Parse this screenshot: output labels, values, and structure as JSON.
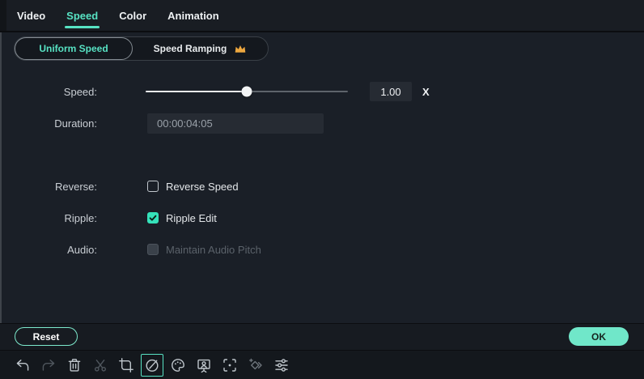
{
  "tabs": [
    {
      "label": "Video",
      "active": false
    },
    {
      "label": "Speed",
      "active": true
    },
    {
      "label": "Color",
      "active": false
    },
    {
      "label": "Animation",
      "active": false
    }
  ],
  "mode_toggle": {
    "options": [
      {
        "label": "Uniform Speed",
        "selected": true
      },
      {
        "label": "Speed Ramping",
        "selected": false,
        "premium": true,
        "premium_icon": "crown-icon"
      }
    ]
  },
  "form": {
    "speed": {
      "label": "Speed:",
      "value": "1.00",
      "multiplier": "X",
      "slider_percent": 50
    },
    "duration": {
      "label": "Duration:",
      "value": "00:00:04:05"
    },
    "reverse": {
      "label": "Reverse:",
      "checkbox_label": "Reverse Speed",
      "checked": false
    },
    "ripple": {
      "label": "Ripple:",
      "checkbox_label": "Ripple Edit",
      "checked": true
    },
    "audio": {
      "label": "Audio:",
      "checkbox_label": "Maintain Audio Pitch",
      "checked": false,
      "disabled": true
    }
  },
  "footer": {
    "reset_label": "Reset",
    "ok_label": "OK"
  },
  "toolbar": {
    "icons": [
      {
        "name": "undo"
      },
      {
        "name": "redo",
        "disabled": true
      },
      {
        "name": "trash"
      },
      {
        "name": "scissors",
        "disabled": true
      },
      {
        "name": "crop"
      },
      {
        "name": "speedometer",
        "active": true
      },
      {
        "name": "palette"
      },
      {
        "name": "presenter-board"
      },
      {
        "name": "focus-brackets"
      },
      {
        "name": "keyframe-diamond",
        "dimmed": true
      },
      {
        "name": "sliders"
      }
    ]
  },
  "colors": {
    "accent": "#57e2c3",
    "check": "#35e2ba",
    "ok-fill": "#70e7c9",
    "ok-text": "#16241f",
    "crown": "#eda73f"
  }
}
